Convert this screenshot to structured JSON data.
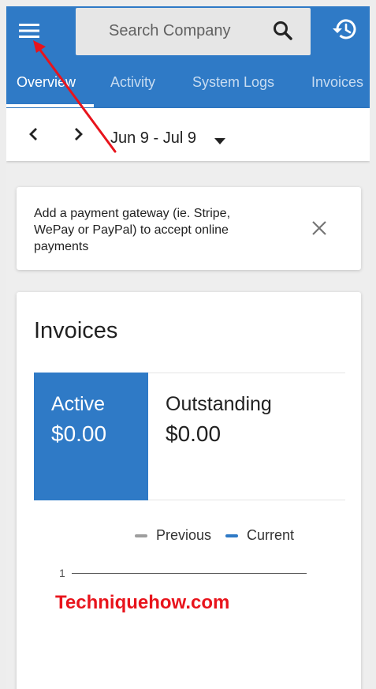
{
  "header": {
    "search_placeholder": "Search Company",
    "tabs": [
      {
        "label": "Overview"
      },
      {
        "label": "Activity"
      },
      {
        "label": "System Logs"
      },
      {
        "label": "Invoices"
      }
    ],
    "active_tab": "Overview"
  },
  "date_bar": {
    "range": "Jun 9 - Jul 9"
  },
  "alert": {
    "message": "Add a payment gateway (ie. Stripe, WePay or PayPal) to accept online payments"
  },
  "invoices": {
    "title": "Invoices",
    "active_label": "Active",
    "active_value": "$0.00",
    "outstanding_label": "Outstanding",
    "outstanding_value": "$0.00",
    "legend": [
      {
        "label": "Previous",
        "color": "#9e9e9e"
      },
      {
        "label": "Current",
        "color": "#2f7ac6"
      }
    ],
    "axis_tick": "1"
  },
  "watermark": "Techniquehow.com",
  "colors": {
    "brand": "#2f7ac6",
    "annotation": "#e8141c"
  },
  "icons": [
    "menu-icon",
    "search-icon",
    "history-icon",
    "chevron-left-icon",
    "chevron-right-icon",
    "caret-down-icon",
    "close-icon"
  ]
}
